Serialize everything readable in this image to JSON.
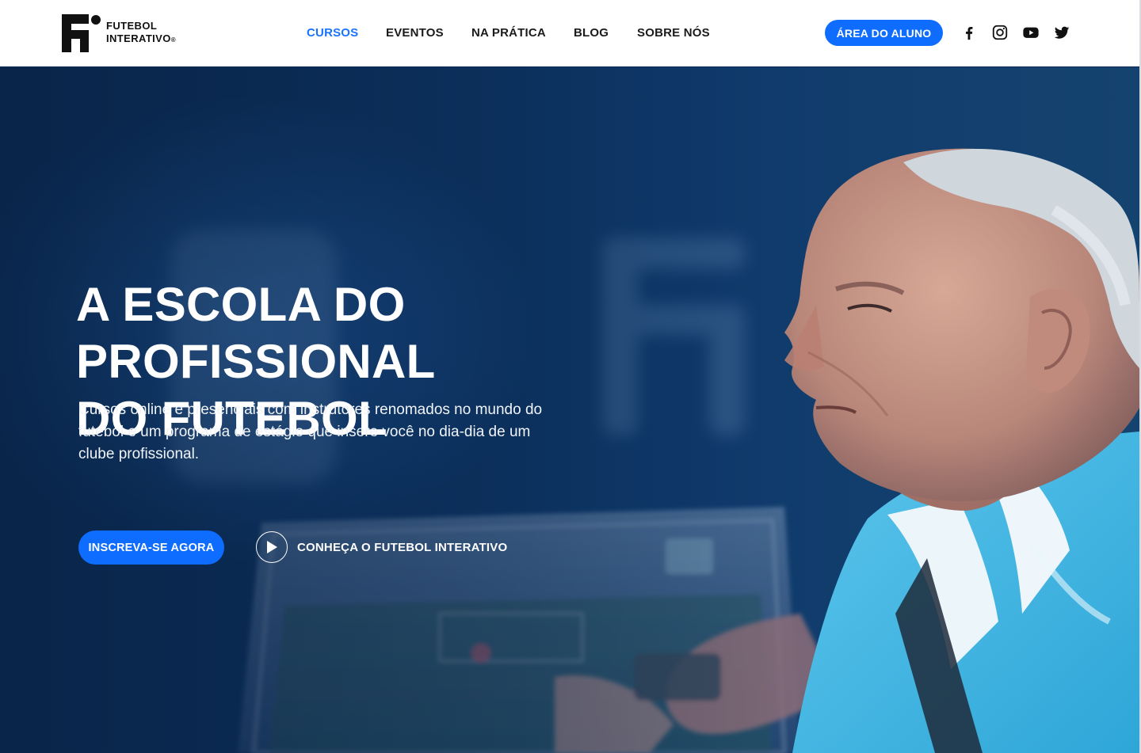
{
  "header": {
    "logo": {
      "line1": "FUTEBOL",
      "line2": "INTERATIVO",
      "reg": "®"
    },
    "nav": [
      {
        "label": "CURSOS",
        "active": true
      },
      {
        "label": "EVENTOS",
        "active": false
      },
      {
        "label": "NA PRÁTICA",
        "active": false
      },
      {
        "label": "BLOG",
        "active": false
      },
      {
        "label": "SOBRE NÓS",
        "active": false
      }
    ],
    "student_area_label": "ÁREA DO ALUNO",
    "socials": [
      "facebook-icon",
      "instagram-icon",
      "youtube-icon",
      "twitter-icon"
    ]
  },
  "hero": {
    "title_line1": "A ESCOLA DO PROFISSIONAL",
    "title_line2": "DO FUTEBOL",
    "subtitle": "Cursos online e presenciais com instrutores renomados no mundo do futebol e um programa de estágio que insere você no dia-dia de um clube profissional.",
    "cta_primary": "INSCREVA-SE AGORA",
    "cta_video": "CONHEÇA O FUTEBOL INTERATIVO"
  },
  "colors": {
    "accent": "#0e6cff",
    "nav_active": "#1a73ff",
    "hero_bg": "#0b2d57",
    "shirt": "#39b6e6"
  }
}
